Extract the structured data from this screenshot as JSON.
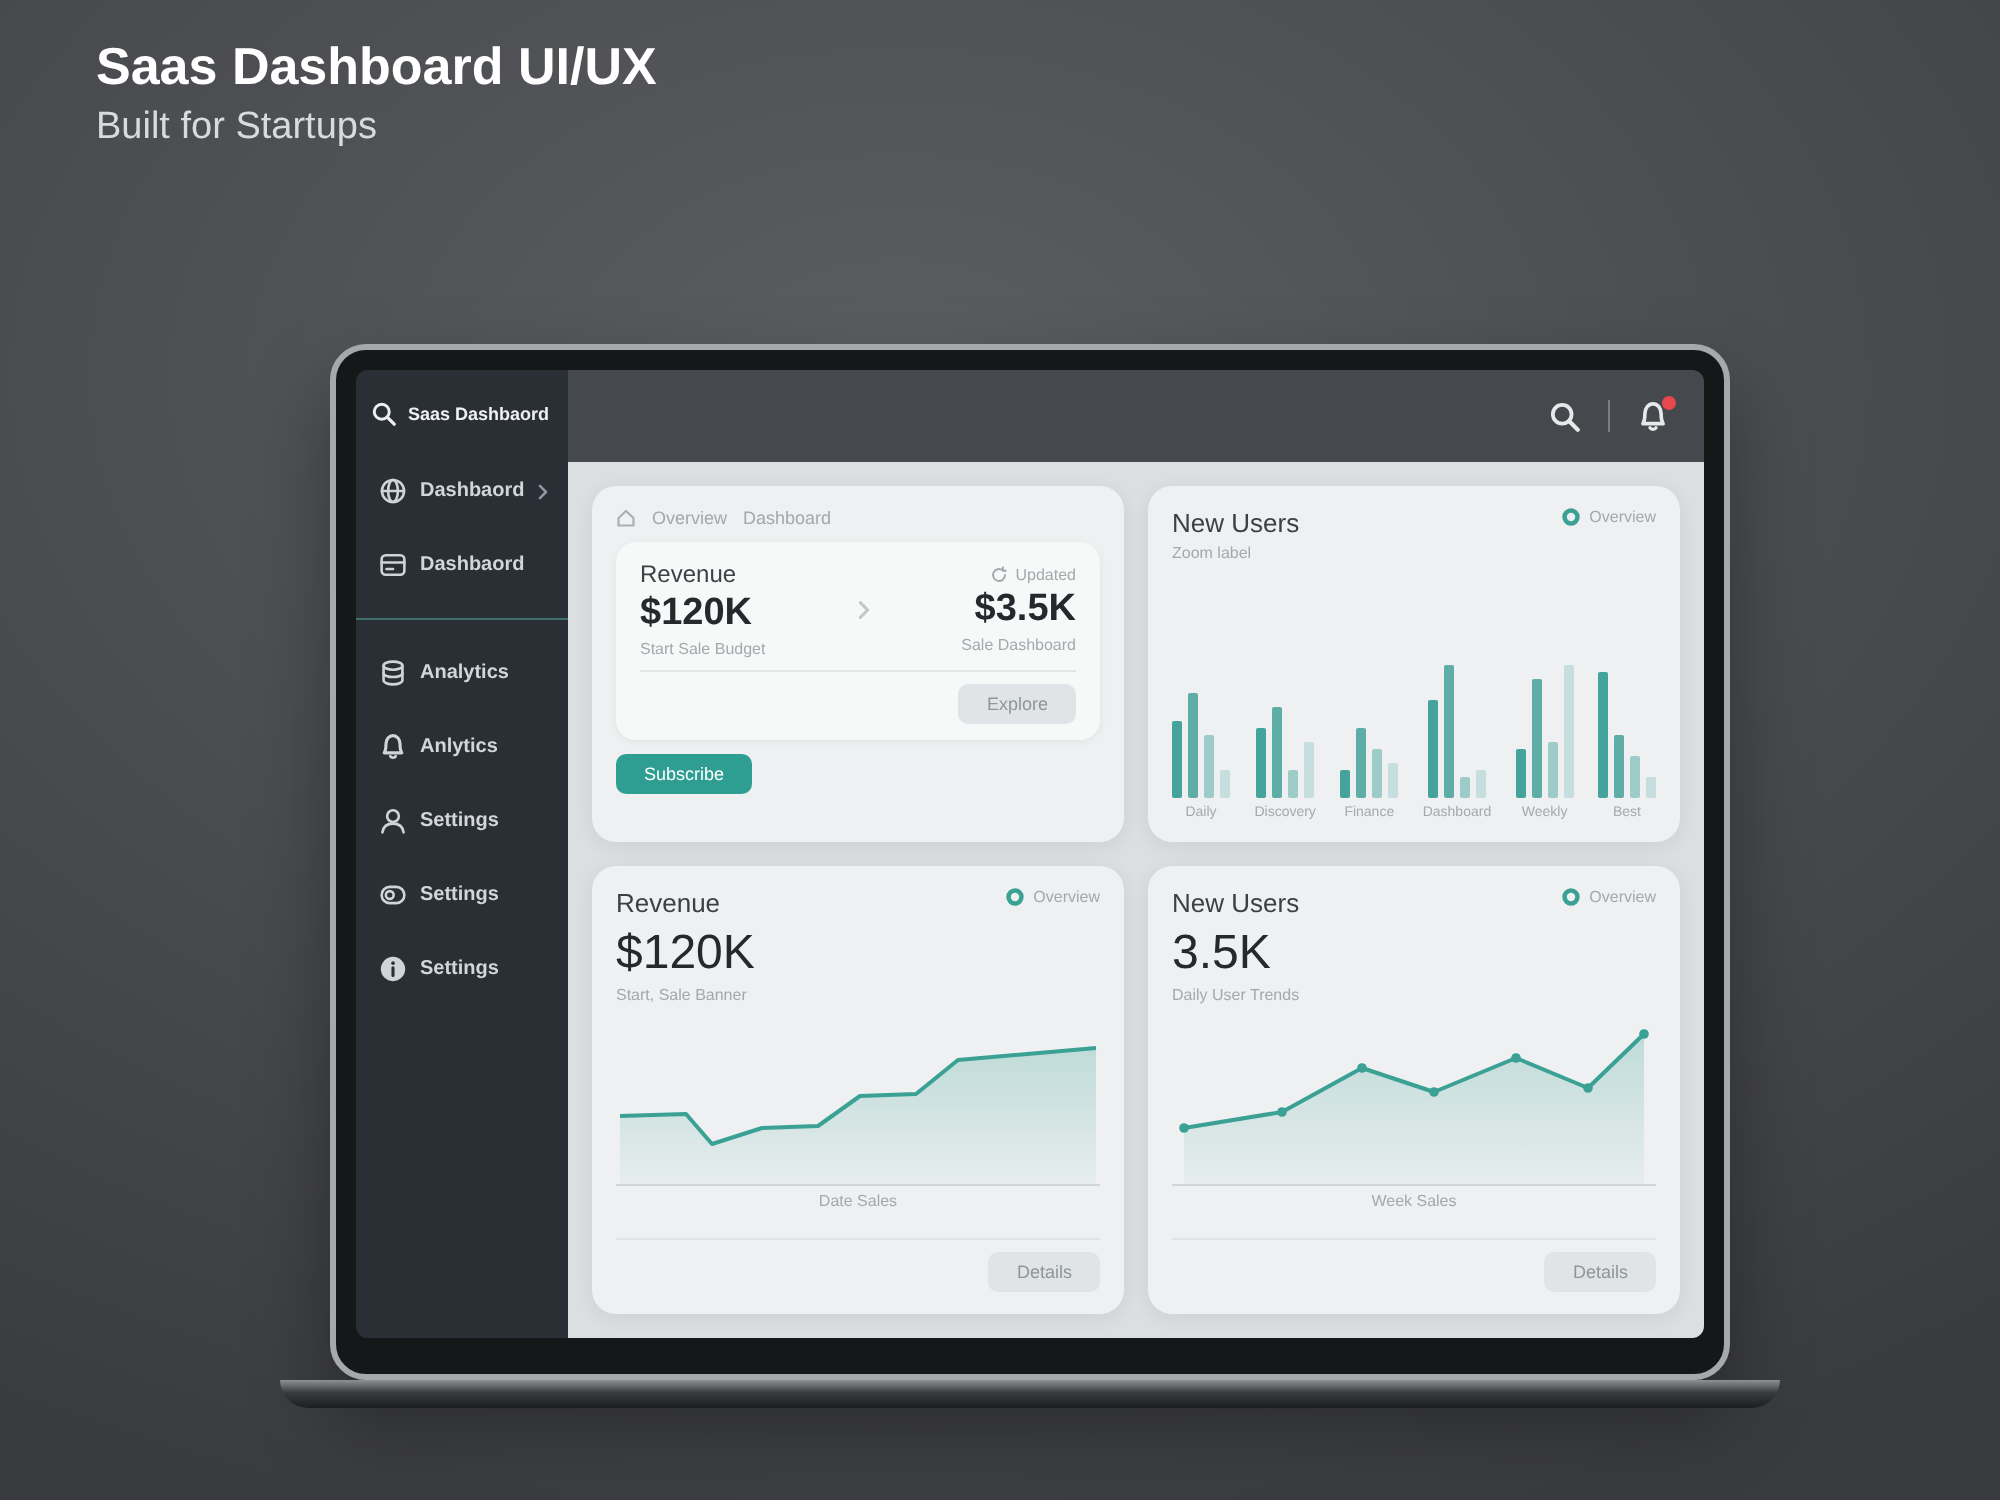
{
  "hero": {
    "title": "Saas Dashboard UI/UX",
    "subtitle": "Built for Startups"
  },
  "topbar": {
    "bell": {
      "unread": true
    }
  },
  "sidebar": {
    "header": "Saas Dashbaord",
    "sections": [
      {
        "items": [
          {
            "label": "Dashbaord",
            "expandable": true
          },
          {
            "label": "Dashbaord",
            "expandable": false
          }
        ]
      },
      {
        "items": [
          {
            "label": "Analytics",
            "expandable": false
          },
          {
            "label": "Anlytics",
            "expandable": false
          },
          {
            "label": "Settings",
            "expandable": false
          },
          {
            "label": "Settings",
            "expandable": false
          },
          {
            "label": "Settings",
            "expandable": false
          }
        ]
      }
    ]
  },
  "cards": [
    {
      "kind": "summary",
      "breadcrumb": [
        "Overview",
        "Dashboard"
      ],
      "panel": {
        "metric": {
          "label": "Revenue",
          "value": "$120K",
          "caption": "Start Sale Budget"
        },
        "comparison": {
          "tag": "Updated",
          "value": "$3.5K",
          "caption": "Sale Dashboard"
        },
        "buttons": [
          {
            "label": "Explore",
            "kind": "secondary"
          }
        ]
      },
      "buttons": [
        {
          "label": "Subscribe",
          "kind": "primary"
        }
      ]
    },
    {
      "kind": "bars",
      "title": "New Users",
      "caption": "Zoom label",
      "legend": "Overview",
      "x_labels": [
        "Daily",
        "Discovery",
        "Finance",
        "Dashboard",
        "Weekly",
        "Best"
      ]
    },
    {
      "kind": "area",
      "title": "Revenue",
      "value": "$120K",
      "caption": "Start, Sale Banner",
      "legend": "Overview",
      "axis_label": "Date Sales",
      "buttons": [
        {
          "label": "Details",
          "kind": "secondary"
        }
      ]
    },
    {
      "kind": "area",
      "title": "New Users",
      "value": "3.5K",
      "caption": "Daily User Trends",
      "legend": "Overview",
      "axis_label": "Week Sales",
      "buttons": [
        {
          "label": "Details",
          "kind": "secondary"
        }
      ]
    }
  ]
}
